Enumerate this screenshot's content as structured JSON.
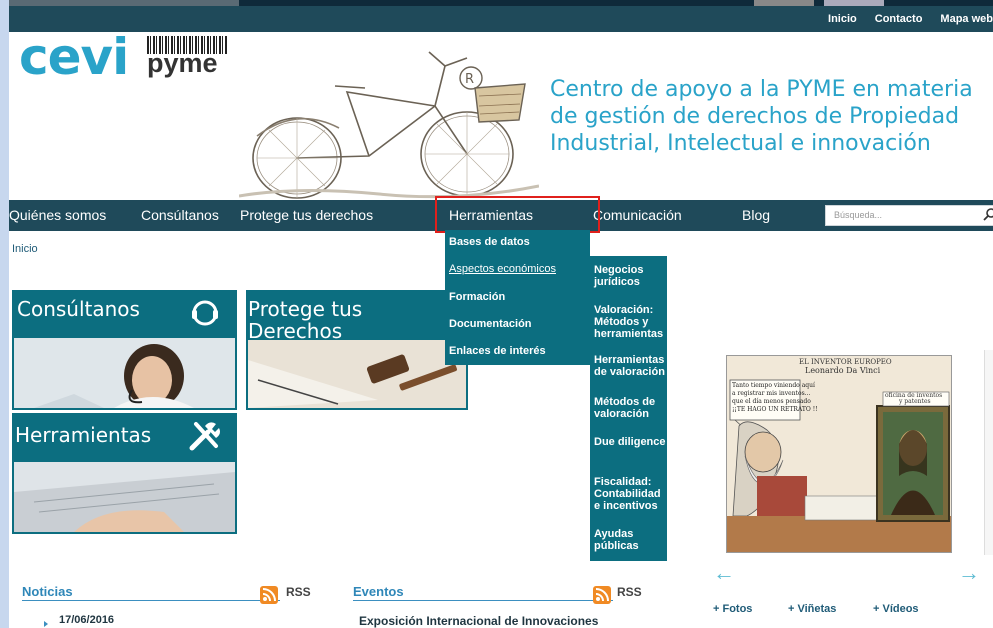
{
  "top_links": [
    "Inicio",
    "Contacto",
    "Mapa web"
  ],
  "logo": {
    "cevi": "cevi",
    "pyme": "pyme"
  },
  "tagline": "Centro de apoyo a la PYME en materia de gestión de derechos de Propiedad Industrial, Intelectual e innovación",
  "nav": {
    "items": [
      "Quiénes somos",
      "Consúltanos",
      "Protege tus derechos",
      "Herramientas",
      "Comunicación",
      "Blog"
    ],
    "search_placeholder": "Búsqueda..."
  },
  "breadcrumb": "Inicio",
  "tiles": {
    "consultanos": "Consúltanos",
    "protege_line1": "Protege tus",
    "protege_line2": "Derechos",
    "herramientas": "Herramientas"
  },
  "dropdown": {
    "items": [
      "Bases de datos",
      "Aspectos económicos",
      "Formación",
      "Documentación",
      "Enlaces de interés"
    ]
  },
  "submenu": {
    "items": [
      "Negocios jurídicos",
      "Valoración: Métodos y herramientas",
      "Herramientas de valoración",
      "Métodos de valoración",
      "Due diligence",
      "Fiscalidad: Contabilidad e incentivos",
      "Ayudas públicas"
    ]
  },
  "cartoon": {
    "title_line1": "EL INVENTOR EUROPEO",
    "title_line2": "Leonardo Da Vinci",
    "bubble": [
      "Tanto tiempo viniendo aquí",
      "a registrar mis inventos...",
      "que el día menos pensado",
      "¡¡TE HAGO UN RETRATO !!"
    ],
    "sign_line1": "oficina de inventos",
    "sign_line2": "y patentes"
  },
  "media_links": [
    "+ Fotos",
    "+ Viñetas",
    "+ Vídeos"
  ],
  "noticias": {
    "title": "Noticias",
    "rss": "RSS",
    "date": "17/06/2016"
  },
  "eventos": {
    "title": "Eventos",
    "rss": "RSS",
    "first": "Exposición Internacional de Innovaciones"
  },
  "colors": {
    "teal": "#0c6e80",
    "dark_bar": "#1f4a5a",
    "brand_blue": "#2aa3c9",
    "highlight": "#e0201c"
  }
}
